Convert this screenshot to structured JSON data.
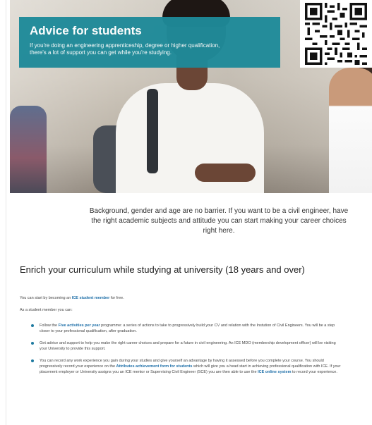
{
  "hero": {
    "title": "Advice for students",
    "subtitle_line1": "If you're doing an engineering apprenticeship, degree or higher qualification,",
    "subtitle_line2": "there's a lot of support you can get while you're studying."
  },
  "intro": "Background, gender and age are no barrier. If you want to be a civil engineer, have the right academic subjects and attitude you can start making your career choices right here.",
  "section": {
    "title": "Enrich your curriculum while studying at university (18 years and over)",
    "p1_prefix": "You can start by becoming an ",
    "p1_link": "ICE student member",
    "p1_suffix": " for free.",
    "p2": "As a student member you can:"
  },
  "bullets": [
    {
      "prefix": "Follow the ",
      "link": "Five activities per year",
      "suffix": " programme: a series of actions to take to progressively build your CV and relation with the Instution of Civil Engineers. You will be a step closer to your professional qualification, after graduation."
    },
    {
      "text": "Get advice and support to help you make the right career choices and prepare for a future in civil engineering. An ICE MDO (membership development officer) will be visiting your University to provide this support."
    },
    {
      "prefix": "You can record any work experience you gain during your studies and give yourself an advantage by having it assessed before you complete your course. You should progressively record your experience on the ",
      "link": "Attributes achievement form for students",
      "middle": " which will give you a head start in achieving professional qualification with ICE. If your placement employer or University assigns you an ICE mentor or Supervising Civil Engineer (SCE) you are then able to use the ",
      "link2": "ICE online system",
      "suffix": " to record your experience."
    }
  ],
  "colors": {
    "overlay": "#1e8a99",
    "link": "#1e6fa8",
    "bullet": "#1e7aa0"
  },
  "icons": {
    "qr": "qr-code-icon"
  }
}
